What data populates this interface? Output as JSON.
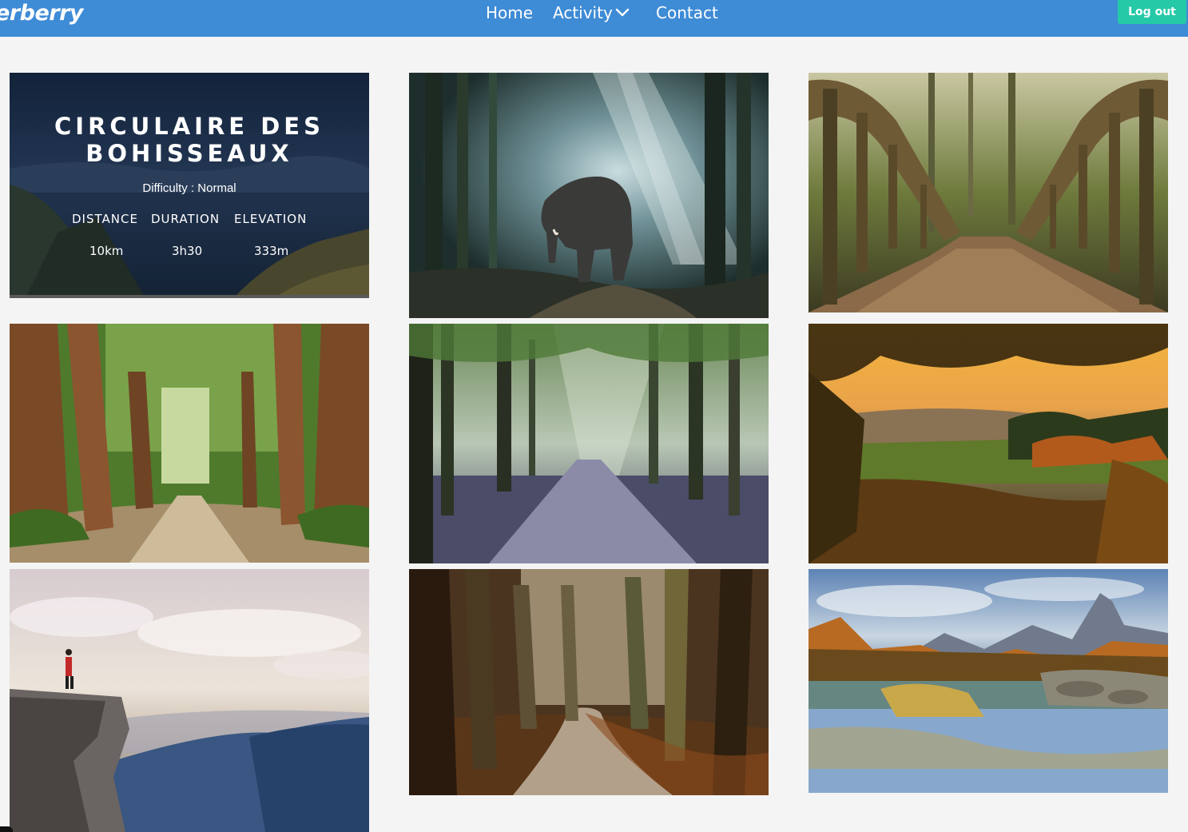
{
  "nav": {
    "brand": "erberry",
    "links": {
      "home": "Home",
      "activity": "Activity",
      "contact": "Contact"
    },
    "logout_label": "Log out",
    "colors": {
      "bar": "#3e8bd6",
      "logout": "#25c9a7"
    }
  },
  "hike_card": {
    "title_line1": "CIRCULAIRE DES",
    "title_line2": "BOHISSEAUX",
    "difficulty": "Difficulty : Normal",
    "stats": {
      "distance_label": "DISTANCE",
      "duration_label": "DURATION",
      "elevation_label": "ELEVATION",
      "distance_value": "10km",
      "duration_value": "3h30",
      "elevation_value": "333m"
    }
  },
  "gallery": [
    {
      "name": "elephant-forest"
    },
    {
      "name": "wooden-bridge"
    },
    {
      "name": "sequoia-path"
    },
    {
      "name": "misty-forest-road"
    },
    {
      "name": "autumn-sunset-valley"
    },
    {
      "name": "cliff-hiker"
    },
    {
      "name": "autumn-forest-path"
    },
    {
      "name": "mountain-lake"
    }
  ]
}
